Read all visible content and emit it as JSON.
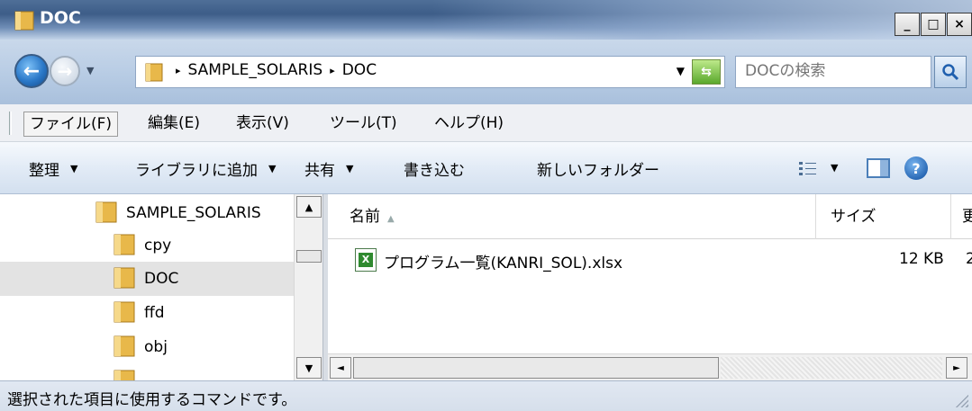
{
  "window": {
    "title": "DOC",
    "min_label": "_",
    "max_label": "□",
    "close_label": "×"
  },
  "address": {
    "back_glyph": "←",
    "forward_glyph": "→",
    "breadcrumb": [
      "SAMPLE_SOLARIS",
      "DOC"
    ],
    "breadcrumb_sep": "▸",
    "dropdown_glyph": "▼",
    "refresh_glyph": "⇆"
  },
  "search": {
    "placeholder": "DOCの検索"
  },
  "menu": {
    "items": [
      "ファイル(F)",
      "編集(E)",
      "表示(V)",
      "ツール(T)",
      "ヘルプ(H)"
    ]
  },
  "toolbar": {
    "organize": "整理",
    "add_to_library": "ライブラリに追加",
    "share": "共有",
    "burn": "書き込む",
    "new_folder": "新しいフォルダー",
    "dropdown_glyph": "▼",
    "help_glyph": "?"
  },
  "navpane": {
    "root": "SAMPLE_SOLARIS",
    "children": [
      "cpy",
      "DOC",
      "ffd",
      "obj"
    ],
    "selected": "DOC",
    "scroll_up": "▲",
    "scroll_down": "▼"
  },
  "filelist": {
    "columns": [
      "名前",
      "サイズ",
      "更"
    ],
    "sort_glyph": "▲",
    "files": [
      {
        "name": "プログラム一覧(KANRI_SOL).xlsx",
        "size": "12 KB",
        "date": "2"
      }
    ],
    "scroll_left": "◄",
    "scroll_right": "►"
  },
  "status": {
    "text": "選択された項目に使用するコマンドです。"
  },
  "colors": {
    "folder": "#e8b84a",
    "title_text": "#ffffff"
  }
}
